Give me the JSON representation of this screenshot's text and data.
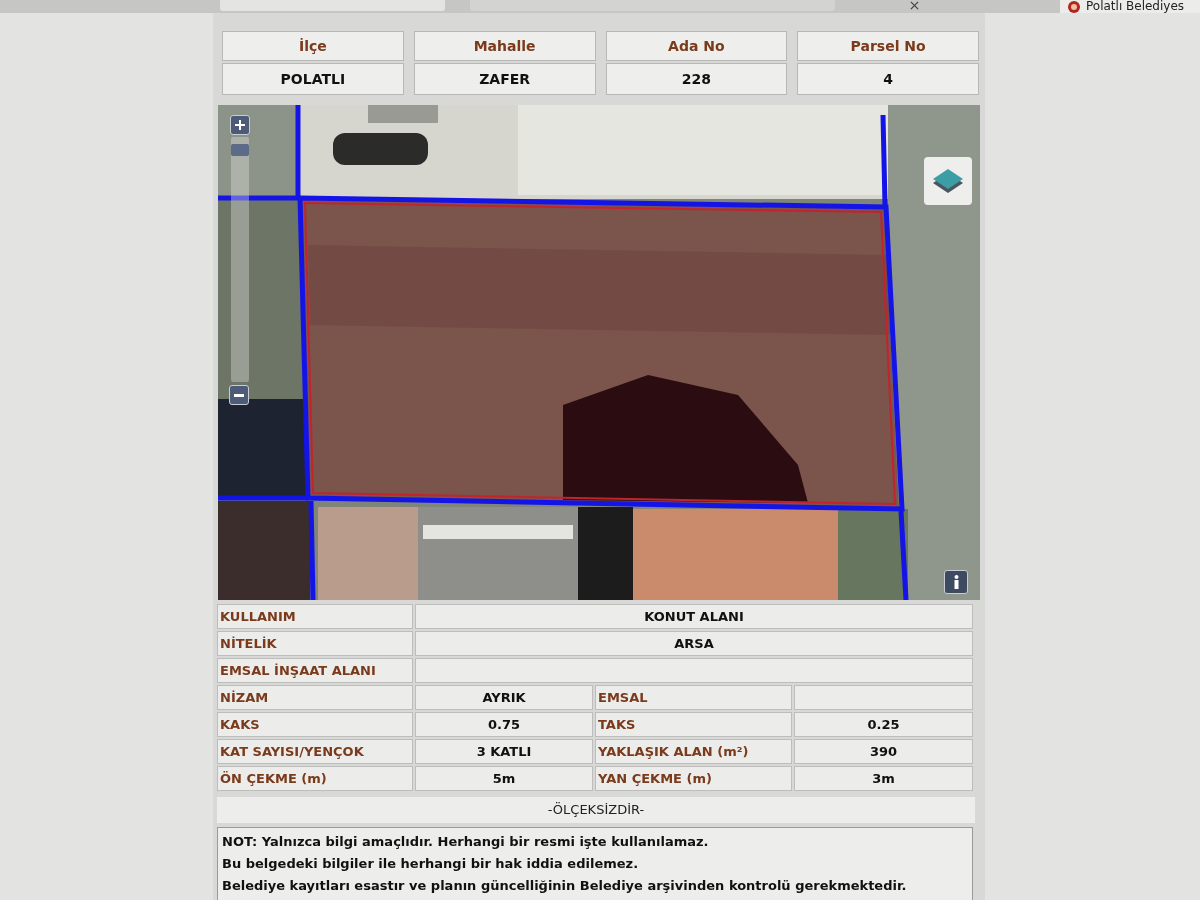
{
  "browser_tabs": {
    "right_tab": {
      "title": "Polatlı Belediyes"
    }
  },
  "header": {
    "columns": [
      {
        "label": "İlçe",
        "value": "POLATLI"
      },
      {
        "label": "Mahalle",
        "value": "ZAFER"
      },
      {
        "label": "Ada No",
        "value": "228"
      },
      {
        "label": "Parsel No",
        "value": "4"
      }
    ]
  },
  "map": {
    "zoom_slider": {
      "level": 0.97
    }
  },
  "details": {
    "rows": [
      {
        "kind": "wide",
        "label": "KULLANIM",
        "value": "KONUT ALANI"
      },
      {
        "kind": "wide",
        "label": "NİTELİK",
        "value": "ARSA"
      },
      {
        "kind": "wide",
        "label": "EMSAL İNŞAAT ALANI"
      },
      {
        "kind": "split",
        "label": "NİZAM",
        "value": "AYRIK",
        "label_2": "EMSAL"
      },
      {
        "kind": "split",
        "label": "KAKS",
        "value": "0.75",
        "label_2": "TAKS",
        "value_2": "0.25"
      },
      {
        "kind": "split",
        "label": "KAT SAYISI/YENÇOK",
        "value": "3 KATLI",
        "label_2": "YAKLAŞIK ALAN (m²)",
        "value_2": "390"
      },
      {
        "kind": "split",
        "label": "ÖN ÇEKME (m)",
        "value": "5m",
        "label_2": "YAN ÇEKME (m)",
        "value_2": "3m"
      }
    ]
  },
  "scale_note": "-ÖLÇEKSİZDİR-",
  "notes": [
    "NOT: Yalnızca bilgi amaçlıdır. Herhangi bir resmi işte kullanılamaz.",
    "Bu belgedeki bilgiler ile herhangi bir hak iddia edilemez.",
    "Belediye kayıtları esastır ve planın güncelliğinin Belediye arşivinden kontrolü gerekmektedir."
  ]
}
